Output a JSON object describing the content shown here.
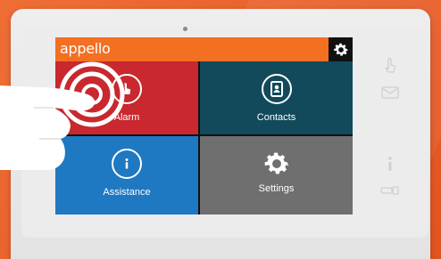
{
  "brand": {
    "logo": "appello"
  },
  "tiles": [
    {
      "id": "alarm",
      "label": "Alarm",
      "icon": "hand-touch-icon"
    },
    {
      "id": "contacts",
      "label": "Contacts",
      "icon": "contact-book-icon"
    },
    {
      "id": "assistance",
      "label": "Assistance",
      "icon": "info-bubble-icon"
    },
    {
      "id": "settings",
      "label": "Settings",
      "icon": "gear-icon"
    }
  ],
  "colors": {
    "background": "#e85f2a",
    "topbar": "#f36f21",
    "alarm": "#c8282e",
    "contacts": "#124a5b",
    "assistance": "#1e78c2",
    "settings": "#6f6f6f"
  }
}
